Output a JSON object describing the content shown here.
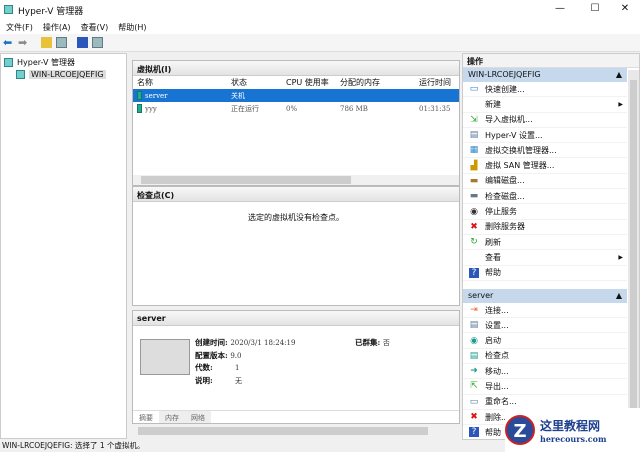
{
  "window": {
    "title": "Hyper-V 管理器",
    "minimize": "—",
    "maximize": "☐",
    "close": "✕"
  },
  "menu": [
    "文件(F)",
    "操作(A)",
    "查看(V)",
    "帮助(H)"
  ],
  "tree": {
    "root": "Hyper-V 管理器",
    "server": "WIN-LRCOEJQEFIG"
  },
  "vms": {
    "title": "虚拟机(I)",
    "columns": [
      "名称",
      "状态",
      "CPU 使用率",
      "分配的内存",
      "运行时间"
    ],
    "rows": [
      [
        "server",
        "关机",
        "",
        "",
        ""
      ],
      [
        "yyy",
        "正在运行",
        "0%",
        "786 MB",
        "01:31:35"
      ]
    ]
  },
  "checkpoints": {
    "title": "检查点(C)",
    "empty": "选定的虚拟机没有检查点。"
  },
  "details": {
    "title": "server",
    "created_label": "创建时间:",
    "created": "2020/3/1 18:24:19",
    "config_label": "配置版本:",
    "config": "9.0",
    "gen_label": "代数:",
    "gen": "1",
    "desc_label": "说明:",
    "desc": "无",
    "cluster_label": "已群集:",
    "cluster": "否",
    "tabs": [
      "摘要",
      "内存",
      "网络"
    ]
  },
  "actions": {
    "title": "操作",
    "server_section": "WIN-LRCOEJQEFIG",
    "server_items": [
      {
        "label": "快速创建...",
        "icon": "monitor-icon"
      },
      {
        "label": "新建",
        "icon": "none"
      },
      {
        "label": "导入虚拟机...",
        "icon": "import-icon"
      },
      {
        "label": "Hyper-V 设置...",
        "icon": "settings-icon"
      },
      {
        "label": "虚拟交换机管理器...",
        "icon": "switch-icon"
      },
      {
        "label": "虚拟 SAN 管理器...",
        "icon": "san-icon"
      },
      {
        "label": "编辑磁盘...",
        "icon": "edit-disk-icon"
      },
      {
        "label": "检查磁盘...",
        "icon": "inspect-disk-icon"
      },
      {
        "label": "停止服务",
        "icon": "stop-icon"
      },
      {
        "label": "删除服务器",
        "icon": "delete-icon"
      },
      {
        "label": "刷新",
        "icon": "refresh-icon"
      },
      {
        "label": "查看",
        "icon": "none"
      },
      {
        "label": "帮助",
        "icon": "help-icon"
      }
    ],
    "vm_section": "server",
    "vm_items": [
      {
        "label": "连接...",
        "icon": "connect-icon"
      },
      {
        "label": "设置...",
        "icon": "settings-icon"
      },
      {
        "label": "启动",
        "icon": "start-icon"
      },
      {
        "label": "检查点",
        "icon": "checkpoint-icon"
      },
      {
        "label": "移动...",
        "icon": "move-icon"
      },
      {
        "label": "导出...",
        "icon": "export-icon"
      },
      {
        "label": "重命名...",
        "icon": "rename-icon"
      },
      {
        "label": "删除...",
        "icon": "delete-icon"
      },
      {
        "label": "帮助",
        "icon": "help-icon"
      }
    ]
  },
  "status": "WIN-LRCOEJQEFIG: 选择了 1 个虚拟机。",
  "watermark": {
    "title": "这里教程网",
    "url": "herecours.com"
  }
}
